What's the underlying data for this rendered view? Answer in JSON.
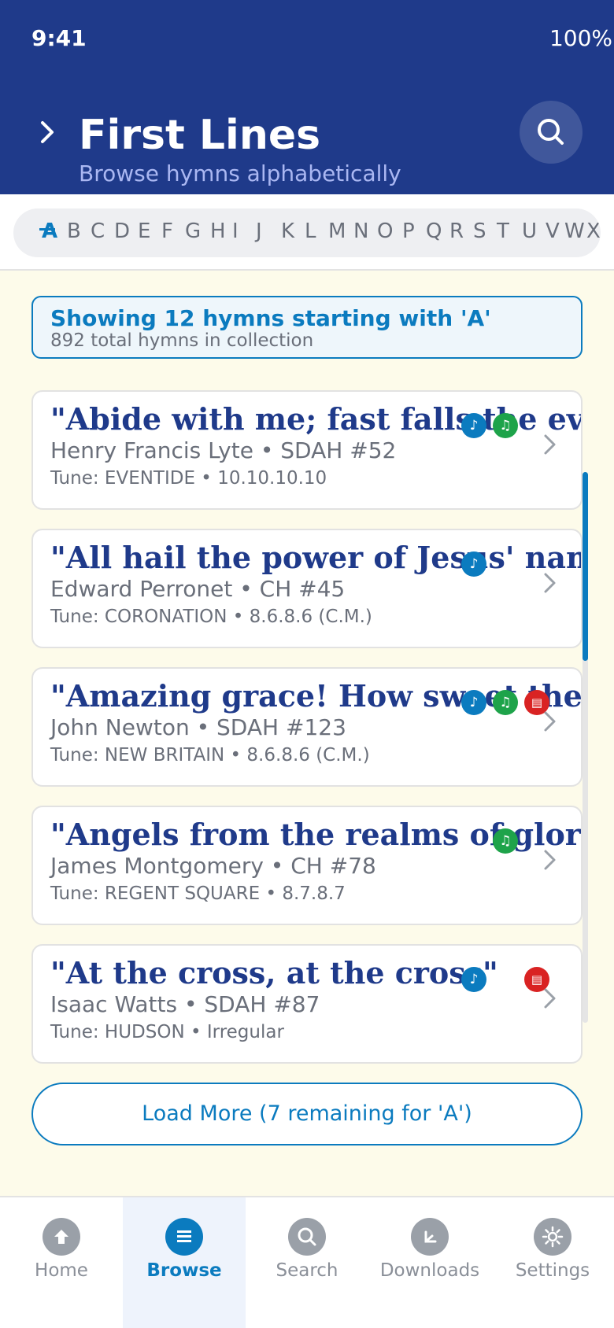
{
  "status": {
    "time": "9:41",
    "battery": "100%"
  },
  "header": {
    "title": "First Lines",
    "subtitle": "Browse hymns alphabetically",
    "back_icon": "chevron-right-icon",
    "search_icon": "search-icon"
  },
  "alphabet": {
    "active": "A",
    "letters": [
      "A",
      "B",
      "C",
      "D",
      "E",
      "F",
      "G",
      "H",
      "I",
      "J",
      "K",
      "L",
      "M",
      "N",
      "O",
      "P",
      "Q",
      "R",
      "S",
      "T",
      "U",
      "V",
      "W",
      "X"
    ]
  },
  "info": {
    "main": "Showing 12 hymns starting with 'A'",
    "sub": "892 total hymns in collection"
  },
  "hymns": [
    {
      "title": "\"Abide with me; fast falls the eventide\"",
      "author": "Henry Francis Lyte • SDAH #52",
      "tune": "Tune: EVENTIDE • 10.10.10.10",
      "badges": [
        "audio",
        "music"
      ]
    },
    {
      "title": "\"All hail the power of Jesus' name!\"",
      "author": "Edward Perronet • CH #45",
      "tune": "Tune: CORONATION • 8.6.8.6 (C.M.)",
      "badges": [
        "audio"
      ]
    },
    {
      "title": "\"Amazing grace! How sweet the sound\"",
      "author": "John Newton • SDAH #123",
      "tune": "Tune: NEW BRITAIN • 8.6.8.6 (C.M.)",
      "badges": [
        "audio",
        "music",
        "pdf"
      ]
    },
    {
      "title": "\"Angels from the realms of glory\"",
      "author": "James Montgomery • CH #78",
      "tune": "Tune: REGENT SQUARE • 8.7.8.7",
      "badges": [
        "music"
      ]
    },
    {
      "title": "\"At the cross, at the cross\"",
      "author": "Isaac Watts • SDAH #87",
      "tune": "Tune: HUDSON • Irregular",
      "badges": [
        "audio",
        "pdf"
      ]
    }
  ],
  "badge_glyphs": {
    "audio": "♪",
    "music": "♫",
    "pdf": "▤"
  },
  "load_more": "Load More (7 remaining for 'A')",
  "nav": [
    {
      "label": "Home",
      "icon": "home-icon"
    },
    {
      "label": "Browse",
      "icon": "list-icon",
      "active": true
    },
    {
      "label": "Search",
      "icon": "search-icon"
    },
    {
      "label": "Downloads",
      "icon": "download-icon"
    },
    {
      "label": "Settings",
      "icon": "gear-icon"
    }
  ],
  "colors": {
    "header": "#1f3a8a",
    "accent": "#0b7bbf",
    "audio": "#0b7bbf",
    "music": "#1ea34a",
    "pdf": "#d92323",
    "background": "#fdfbea"
  }
}
